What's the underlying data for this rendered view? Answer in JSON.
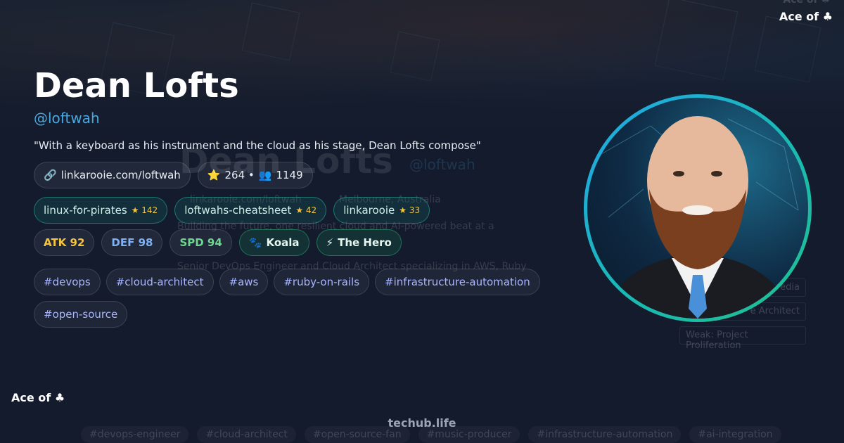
{
  "profile": {
    "name": "Dean Lofts",
    "handle": "@loftwah",
    "quote": "\"With a keyboard as his instrument and the cloud as his stage, Dean Lofts compose\"",
    "link": "linkarooie.com/loftwah",
    "stats": "264 • ",
    "followers": "1149"
  },
  "repos": [
    {
      "name": "linux-for-pirates",
      "stars": "★ 142"
    },
    {
      "name": "loftwahs-cheatsheet",
      "stars": "★ 42"
    },
    {
      "name": "linkarooie",
      "stars": "★ 33"
    }
  ],
  "card_stats": [
    {
      "label": "ATK 92",
      "color": "#f5c542"
    },
    {
      "label": "DEF 98",
      "color": "#7fb2f5"
    },
    {
      "label": "SPD 94",
      "color": "#6fd68f"
    }
  ],
  "badges": [
    {
      "label": "Koala",
      "icon": "🐾"
    },
    {
      "label": "The Hero",
      "icon": "⚡"
    }
  ],
  "tags": [
    "#devops",
    "#cloud-architect",
    "#aws",
    "#ruby-on-rails",
    "#infrastructure-automation",
    "#open-source"
  ],
  "card": {
    "ace_label": "Ace of ♣",
    "site": "techub.life"
  },
  "ghost": {
    "name": "Dean Lofts",
    "handle": "@loftwah",
    "link": "linkarooie.com/loftwah",
    "location": "Melbourne, Australia",
    "line1": "Building the future, one resilient cloud and AI-powered beat at a",
    "line2": "Senior DevOps Engineer and Cloud Architect specializing in AWS, Ruby",
    "box1": "edia",
    "box2": "e Architect",
    "box3": "Weak: Project Proliferation",
    "tags": [
      "#devops-engineer",
      "#cloud-architect",
      "#open-source-fan",
      "#music-producer",
      "#infrastructure-automation",
      "#ai-integration"
    ]
  }
}
